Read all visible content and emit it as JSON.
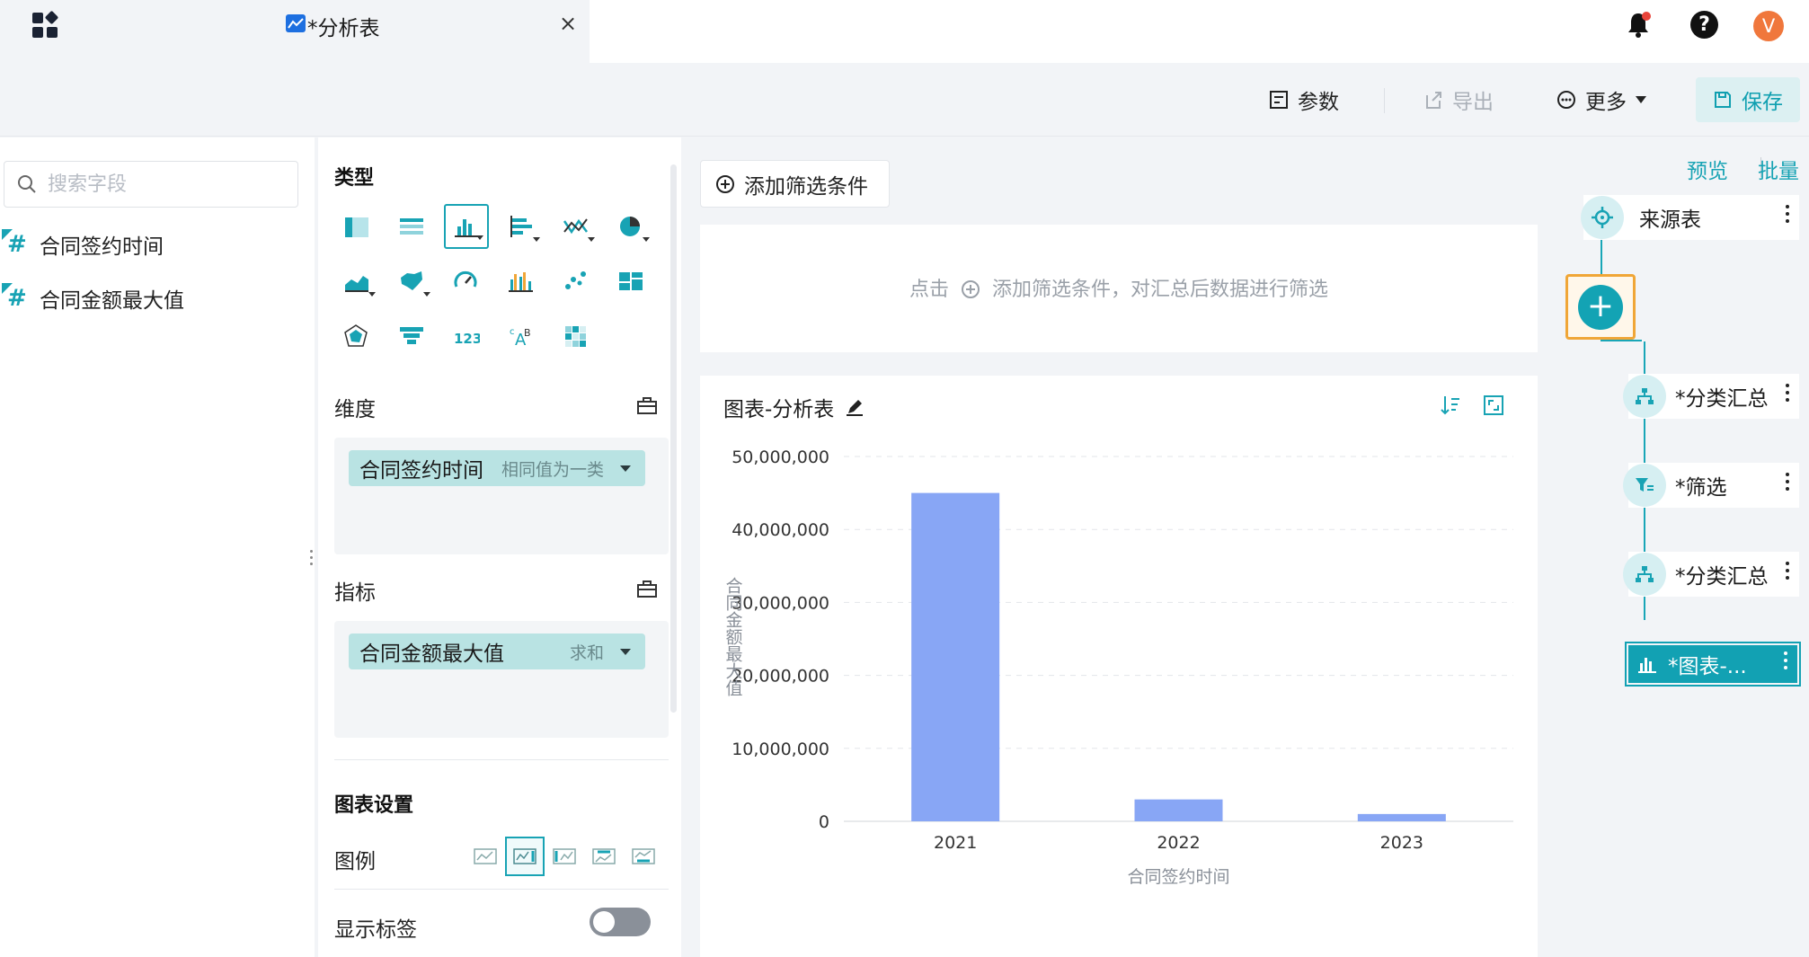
{
  "topbar": {
    "tab_title": "*分析表",
    "tab_close": "×",
    "avatar_letter": "V",
    "help_glyph": "?"
  },
  "toolbar": {
    "params_label": "参数",
    "export_label": "导出",
    "more_label": "更多",
    "save_label": "保存"
  },
  "field_panel": {
    "search_placeholder": "搜索字段",
    "fields": [
      {
        "label": "合同签约时间"
      },
      {
        "label": "合同金额最大值"
      }
    ]
  },
  "config": {
    "type_title": "类型",
    "dimension_title": "维度",
    "dimension_pill": {
      "label": "合同签约时间",
      "hint": "相同值为一类"
    },
    "measure_title": "指标",
    "measure_pill": {
      "label": "合同金额最大值",
      "hint": "求和"
    },
    "chart_settings_title": "图表设置",
    "legend_label": "图例",
    "show_labels_label": "显示标签",
    "show_labels_on": false,
    "type_icons": [
      "grouped-table-icon",
      "detail-table-icon",
      "bar-chart-icon",
      "horizontal-bar-icon",
      "line-chart-icon",
      "pie-chart-icon",
      "area-chart-icon",
      "map-icon",
      "gauge-icon",
      "multi-bar-icon",
      "scatter-icon",
      "dashboard-icon",
      "radar-icon",
      "funnel-icon",
      "number-card-icon",
      "word-cloud-icon",
      "heatmap-icon"
    ],
    "active_type": "bar-chart-icon"
  },
  "filter": {
    "add_button_label": "添加筛选条件",
    "hint_prefix": "点击",
    "hint_suffix": "添加筛选条件，对汇总后数据进行筛选"
  },
  "chart_card": {
    "title": "图表-分析表"
  },
  "chart_data": {
    "type": "bar",
    "categories": [
      "2021",
      "2022",
      "2023"
    ],
    "values": [
      45000000,
      3000000,
      1000000
    ],
    "xlabel": "合同签约时间",
    "ylabel": "合同金额最大值",
    "ylim": [
      0,
      50000000
    ],
    "yticks": [
      0,
      10000000,
      20000000,
      30000000,
      40000000,
      50000000
    ],
    "ytick_labels": [
      "0",
      "10,000,000",
      "20,000,000",
      "30,000,000",
      "40,000,000",
      "50,000,000"
    ],
    "bar_color": "#88a6f5",
    "grid": true,
    "legend": "none"
  },
  "flow": {
    "preview_label": "预览",
    "batch_label": "批量",
    "nodes": [
      {
        "label": "来源表"
      },
      {
        "label": "*分类汇总"
      },
      {
        "label": "*筛选"
      },
      {
        "label": "*分类汇总"
      },
      {
        "label": "*图表-..."
      }
    ],
    "add_glyph": "+"
  },
  "colors": {
    "accent": "#18a3b4",
    "highlight": "#f0a637",
    "bar": "#88a6f5"
  }
}
